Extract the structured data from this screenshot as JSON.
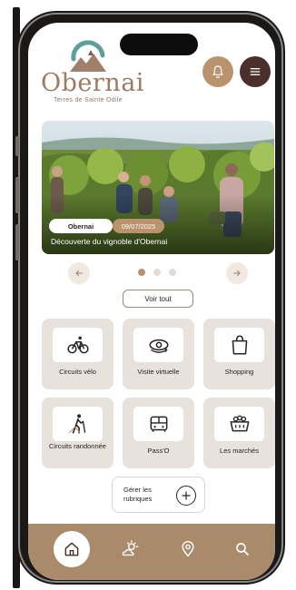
{
  "brand": {
    "name": "Obernai",
    "tagline": "Terres de Sainte Odile",
    "colors": {
      "accent": "#b9936d",
      "dark": "#4a2f2a",
      "nav": "#a98a6a",
      "tile": "#e8e2dc",
      "logo_teal": "#5f9f9a"
    }
  },
  "header": {
    "bell_icon": "bell-icon",
    "menu_icon": "menu-icon"
  },
  "carousel": {
    "card": {
      "tag_city": "Obernai",
      "tag_date": "09/07/2025",
      "title": "Découverte du vignoble d'Obernai"
    },
    "prev_icon": "arrow-left-icon",
    "next_icon": "arrow-right-icon",
    "slides": 3,
    "active_slide": 1,
    "see_all_label": "Voir tout"
  },
  "tiles": [
    {
      "label": "Circuits vélo",
      "icon": "bike-icon"
    },
    {
      "label": "Visite virtuelle",
      "icon": "eye-360-icon"
    },
    {
      "label": "Shopping",
      "icon": "shopping-bag-icon"
    },
    {
      "label": "Circuits randonnée",
      "icon": "hiker-icon"
    },
    {
      "label": "Pass'O",
      "icon": "bus-icon"
    },
    {
      "label": "Les marchés",
      "icon": "market-basket-icon"
    }
  ],
  "manage": {
    "label": "Gérer les rubriques",
    "icon": "plus-circle-icon"
  },
  "bottom_nav": {
    "items": [
      {
        "name": "home",
        "icon": "home-icon",
        "active": true
      },
      {
        "name": "weather",
        "icon": "weather-icon",
        "active": false
      },
      {
        "name": "map",
        "icon": "location-pin-icon",
        "active": false
      },
      {
        "name": "search",
        "icon": "search-icon",
        "active": false
      }
    ]
  }
}
